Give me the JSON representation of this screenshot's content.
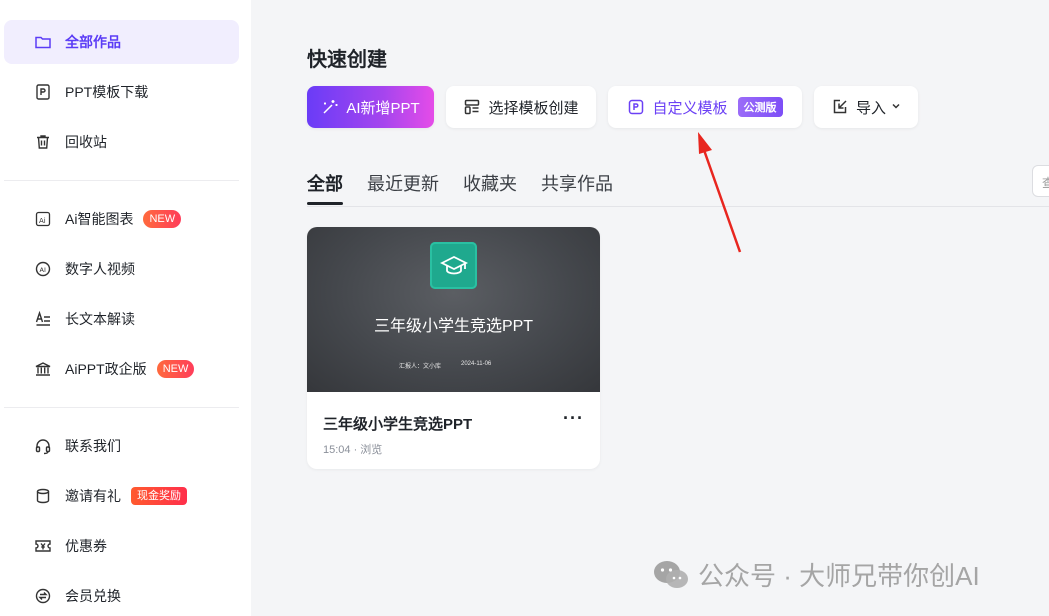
{
  "sidebar": {
    "items": [
      {
        "label": "全部作品",
        "icon": "folder-icon",
        "active": true
      },
      {
        "label": "PPT模板下载",
        "icon": "ppt-file-icon"
      },
      {
        "label": "回收站",
        "icon": "trash-icon"
      },
      {
        "label": "Ai智能图表",
        "icon": "ai-chart-icon",
        "badge": "NEW"
      },
      {
        "label": "数字人视频",
        "icon": "digital-human-icon"
      },
      {
        "label": "长文本解读",
        "icon": "text-read-icon"
      },
      {
        "label": "AiPPT政企版",
        "icon": "bank-icon",
        "badge": "NEW"
      },
      {
        "label": "联系我们",
        "icon": "headset-icon"
      },
      {
        "label": "邀请有礼",
        "icon": "gift-icon",
        "badge": "现金奖励"
      },
      {
        "label": "优惠券",
        "icon": "coupon-icon"
      },
      {
        "label": "会员兑换",
        "icon": "exchange-icon"
      }
    ]
  },
  "main": {
    "section_title": "快速创建",
    "quick_actions": {
      "ai_new": "AI新增PPT",
      "template": "选择模板创建",
      "custom": "自定义模板",
      "custom_tag": "公测版",
      "import": "导入"
    },
    "tabs": [
      "全部",
      "最近更新",
      "收藏夹",
      "共享作品"
    ],
    "search_stub": "查",
    "card": {
      "thumb_title": "三年级小学生竞选PPT",
      "thumb_reporter": "汇报人：文小库",
      "thumb_date": "2024-11-06",
      "title": "三年级小学生竞选PPT",
      "subtitle": "15:04 · 浏览",
      "more": "···"
    }
  },
  "watermark": "公众号 · 大师兄带你创AI",
  "colors": {
    "accent": "#5b3cf6",
    "primary_gradient_start": "#6a3cf7",
    "primary_gradient_end": "#e54ce8",
    "badge_red": "#ff3d5a",
    "annotation_arrow": "#e8261f",
    "thumb_logo": "#1fa98e"
  }
}
